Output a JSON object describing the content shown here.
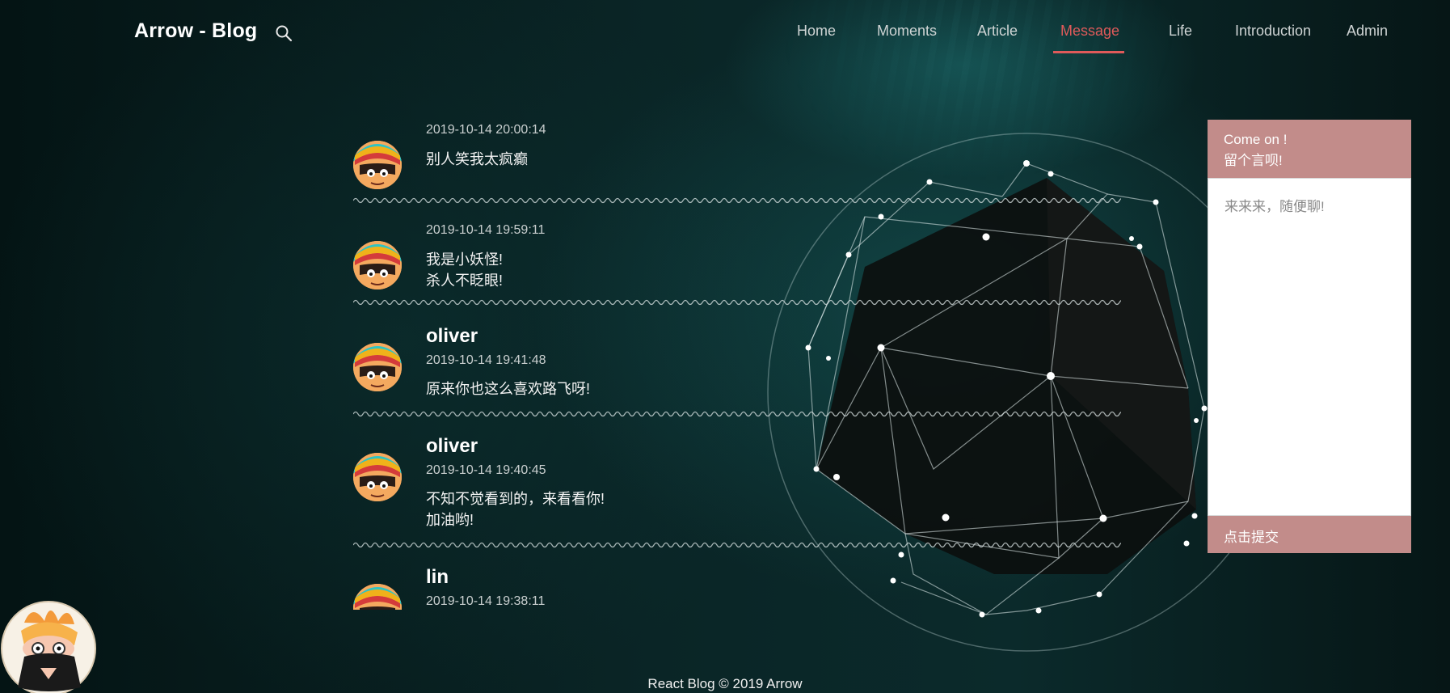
{
  "header": {
    "logo": "Arrow - Blog",
    "nav": [
      {
        "label": "Home",
        "active": false
      },
      {
        "label": "Moments",
        "active": false
      },
      {
        "label": "Article",
        "active": false
      },
      {
        "label": "Message",
        "active": true
      },
      {
        "label": "Life",
        "active": false
      },
      {
        "label": "Introduction",
        "active": false
      },
      {
        "label": "Admin",
        "active": false
      }
    ]
  },
  "messages": [
    {
      "username": "",
      "time": "2019-10-14 20:00:14",
      "lines": [
        "别人笑我太疯癫"
      ]
    },
    {
      "username": "",
      "time": "2019-10-14 19:59:11",
      "lines": [
        "我是小妖怪!",
        "杀人不眨眼!"
      ]
    },
    {
      "username": "oliver",
      "time": "2019-10-14 19:41:48",
      "lines": [
        "原来你也这么喜欢路飞呀!"
      ]
    },
    {
      "username": "oliver",
      "time": "2019-10-14 19:40:45",
      "lines": [
        "不知不觉看到的，来看看你!",
        "加油哟!"
      ]
    },
    {
      "username": "lin",
      "time": "2019-10-14 19:38:11",
      "lines": []
    }
  ],
  "form": {
    "title_line1": "Come on !",
    "title_line2": "留个言呗!",
    "placeholder": "来来来，随便聊!",
    "submit": "点击提交"
  },
  "footer": "React Blog © 2019 Arrow",
  "colors": {
    "accent": "#e05a5a",
    "panel": "#c28c8a",
    "background": "#0b2a2b"
  }
}
